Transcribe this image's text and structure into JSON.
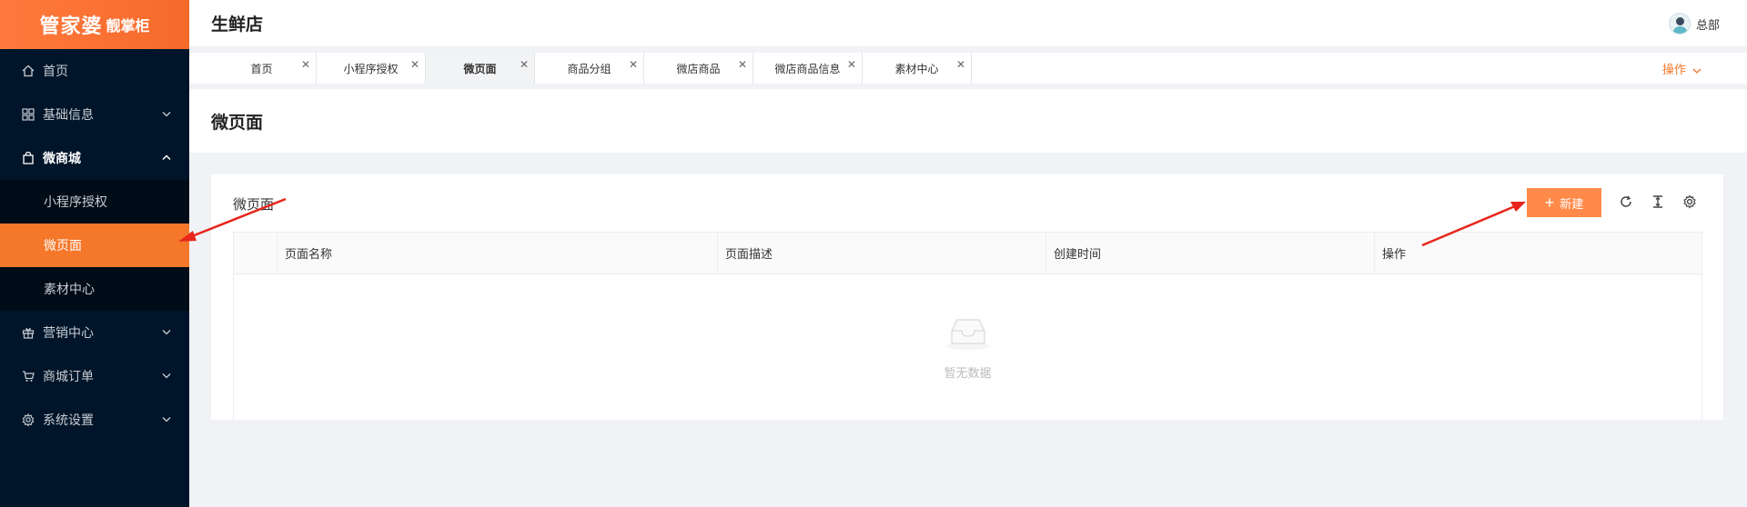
{
  "brand": {
    "logo_main": "管家婆",
    "logo_sub": "靓掌柜"
  },
  "sidebar": {
    "items": [
      {
        "label": "首页",
        "icon": "home-icon"
      },
      {
        "label": "基础信息",
        "icon": "grid-icon"
      },
      {
        "label": "微商城",
        "icon": "bag-icon",
        "expanded": true,
        "children": [
          {
            "label": "小程序授权"
          },
          {
            "label": "微页面",
            "active": true
          },
          {
            "label": "素材中心"
          }
        ]
      },
      {
        "label": "营销中心",
        "icon": "gift-icon"
      },
      {
        "label": "商城订单",
        "icon": "cart-icon"
      },
      {
        "label": "系统设置",
        "icon": "gear-icon"
      }
    ]
  },
  "header": {
    "store_name": "生鲜店",
    "user_name": "总部"
  },
  "tabs": {
    "items": [
      {
        "label": "首页"
      },
      {
        "label": "小程序授权"
      },
      {
        "label": "微页面",
        "active": true
      },
      {
        "label": "商品分组"
      },
      {
        "label": "微店商品"
      },
      {
        "label": "微店商品信息"
      },
      {
        "label": "素材中心"
      }
    ],
    "ops_label": "操作"
  },
  "page": {
    "title": "微页面"
  },
  "card": {
    "title": "微页面",
    "new_button": "新建",
    "table": {
      "columns": [
        "页面名称",
        "页面描述",
        "创建时间",
        "操作"
      ],
      "rows": [],
      "empty_text": "暂无数据"
    }
  },
  "colors": {
    "accent": "#f5772a",
    "sidebar_bg": "#001529",
    "button": "#ff8a4a",
    "annotation": "#e8261c"
  }
}
